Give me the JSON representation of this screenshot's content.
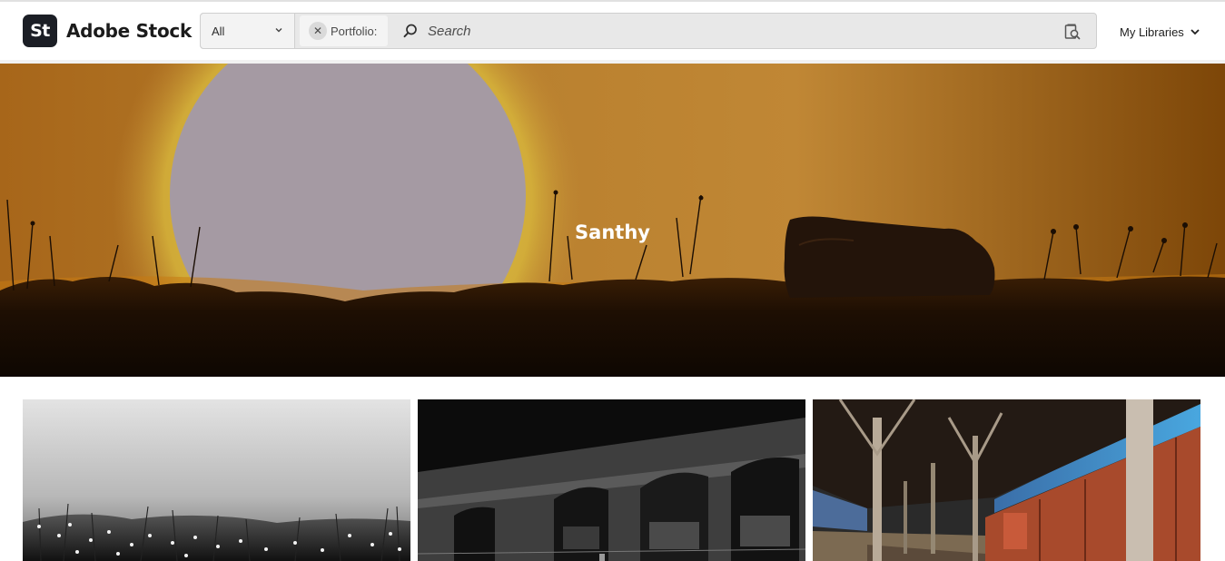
{
  "header": {
    "logo_mark": "St",
    "logo_text": "Adobe Stock",
    "search": {
      "scope_value": "All",
      "filter_chip_label": "Portfolio:",
      "placeholder": "Search"
    },
    "libraries_label": "My Libraries"
  },
  "hero": {
    "title": "Santhy"
  },
  "thumbnails": [
    {
      "subject": "black-and-white-grass-field"
    },
    {
      "subject": "black-and-white-arched-building"
    },
    {
      "subject": "train-platform-red-wagons"
    }
  ],
  "colors": {
    "logo_bg": "#1b1e25",
    "search_bg": "#e8e8e8",
    "hero_sky": "#b7741c"
  }
}
